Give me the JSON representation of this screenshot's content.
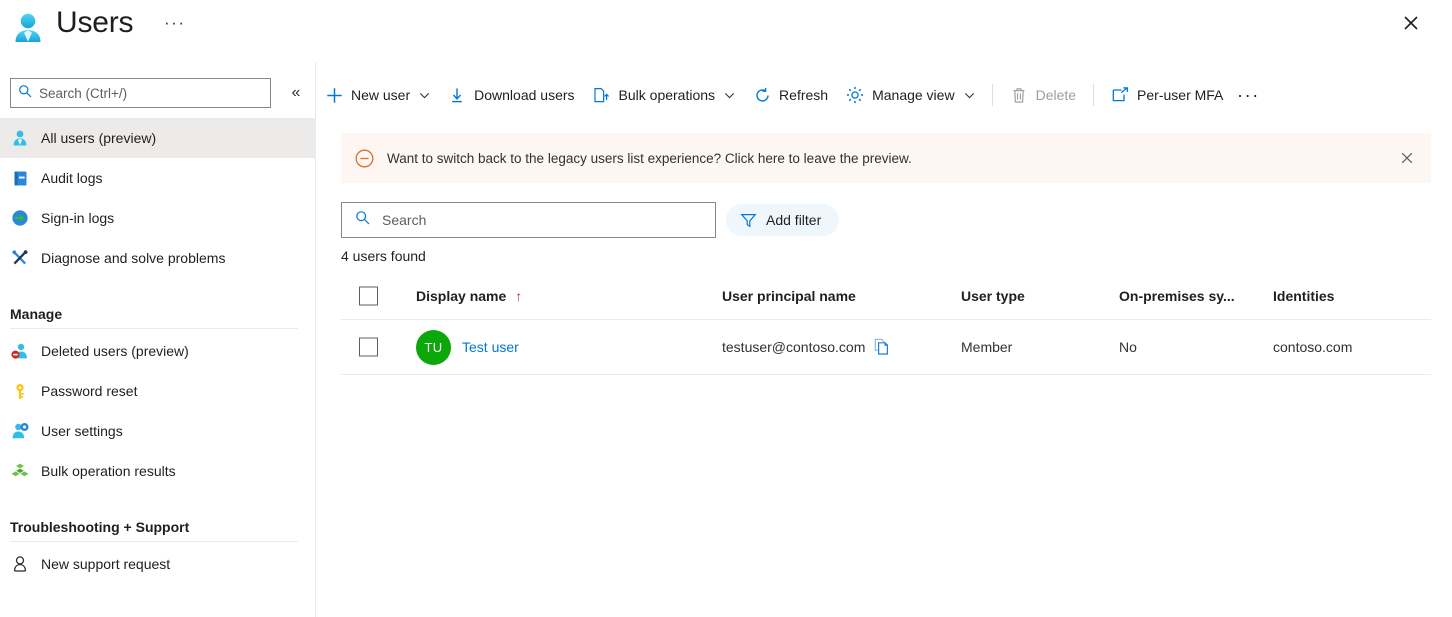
{
  "header": {
    "title": "Users",
    "ellipsis": "···",
    "icon": "user-avatar-icon",
    "close_label": "close-icon"
  },
  "sidebar": {
    "search": {
      "placeholder": "Search (Ctrl+/)",
      "value": ""
    },
    "collapse_label": "«",
    "items": [
      {
        "label": "All users (preview)",
        "icon": "user-icon",
        "selected": true
      },
      {
        "label": "Audit logs",
        "icon": "book-icon",
        "selected": false
      },
      {
        "label": "Sign-in logs",
        "icon": "sign-in-icon",
        "selected": false
      },
      {
        "label": "Diagnose and solve problems",
        "icon": "wrench-screwdriver-icon",
        "selected": false
      }
    ],
    "groups": [
      {
        "title": "Manage",
        "items": [
          {
            "label": "Deleted users (preview)",
            "icon": "user-deleted-icon"
          },
          {
            "label": "Password reset",
            "icon": "key-icon"
          },
          {
            "label": "User settings",
            "icon": "user-gear-icon"
          },
          {
            "label": "Bulk operation results",
            "icon": "cubes-icon"
          }
        ]
      },
      {
        "title": "Troubleshooting + Support",
        "items": [
          {
            "label": "New support request",
            "icon": "support-person-icon"
          }
        ]
      }
    ]
  },
  "toolbar": {
    "items": [
      {
        "label": "New user",
        "icon": "plus-icon",
        "chevron": true,
        "disabled": false
      },
      {
        "label": "Download users",
        "icon": "download-icon",
        "chevron": false,
        "disabled": false
      },
      {
        "label": "Bulk operations",
        "icon": "bulk-upload-icon",
        "chevron": true,
        "disabled": false
      },
      {
        "label": "Refresh",
        "icon": "refresh-icon",
        "chevron": false,
        "disabled": false
      },
      {
        "label": "Manage view",
        "icon": "gear-icon",
        "chevron": true,
        "disabled": false
      },
      {
        "label": "Delete",
        "icon": "trash-icon",
        "chevron": false,
        "disabled": true
      },
      {
        "label": "Per-user MFA",
        "icon": "external-link-icon",
        "chevron": false,
        "disabled": false
      }
    ],
    "more_label": "···"
  },
  "banner": {
    "icon": "minus-circle-icon",
    "text": "Want to switch back to the legacy users list experience? Click here to leave the preview.",
    "close_label": "dismiss-icon",
    "background": "#fdf6f3",
    "accent": "#d8732a"
  },
  "filters": {
    "search": {
      "placeholder": "Search",
      "value": ""
    },
    "add_filter_label": "Add filter",
    "add_filter_icon": "funnel-icon"
  },
  "results": {
    "count_text": "4 users found"
  },
  "table": {
    "columns": [
      {
        "key": "display_name",
        "label": "Display name",
        "sorted": true,
        "sort_arrow": "↑"
      },
      {
        "key": "upn",
        "label": "User principal name",
        "sorted": false
      },
      {
        "key": "user_type",
        "label": "User type",
        "sorted": false
      },
      {
        "key": "on_premises",
        "label": "On-premises sy...",
        "sorted": false
      },
      {
        "key": "identities",
        "label": "Identities",
        "sorted": false
      }
    ],
    "rows": [
      {
        "selected": false,
        "avatar_initials": "TU",
        "avatar_color": "#0ba70b",
        "display_name": "Test user",
        "upn": "testuser@contoso.com",
        "copy_icon": "copy-icon",
        "user_type": "Member",
        "on_premises": "No",
        "identities": "contoso.com"
      }
    ]
  },
  "colors": {
    "accent": "#0078d4",
    "selected_row_bg": "#edebe9",
    "border": "#edebe9",
    "text": "#201f1e"
  }
}
